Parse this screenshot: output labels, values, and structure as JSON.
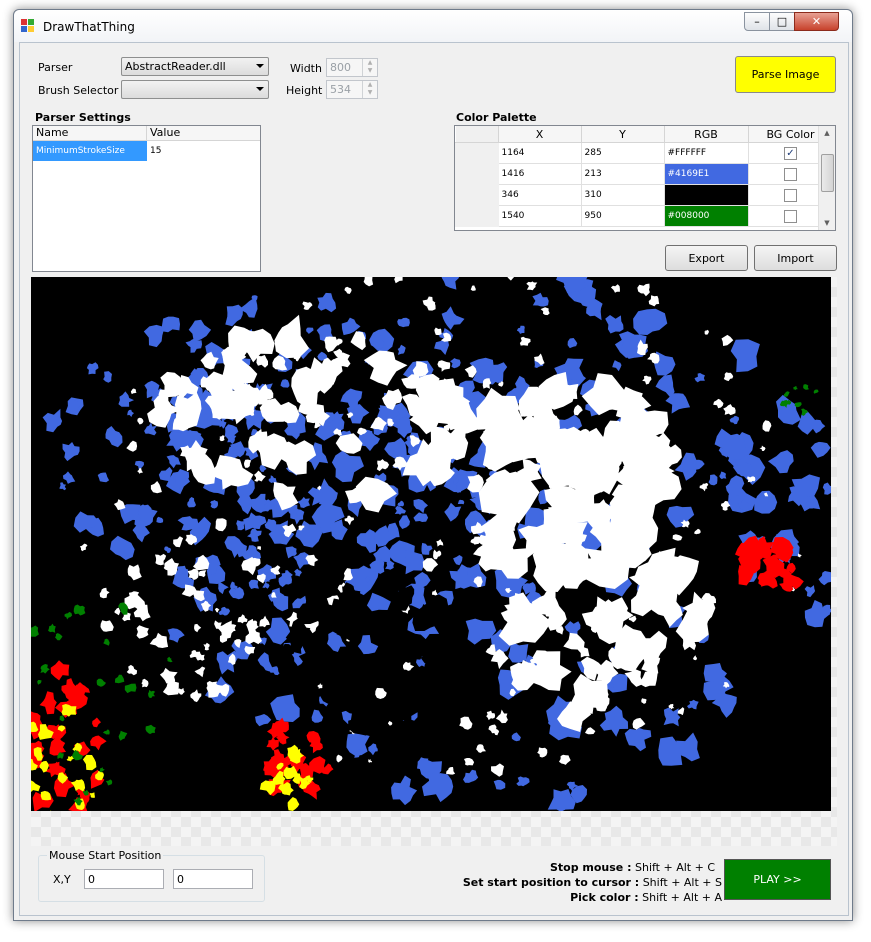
{
  "window": {
    "title": "DrawThatThing",
    "min_label": "–",
    "max_label": "□",
    "close_label": "✕"
  },
  "form": {
    "parser_label": "Parser",
    "parser_value": "AbstractReader.dll",
    "brush_label": "Brush Selector",
    "brush_value": "",
    "width_label": "Width",
    "width_value": "800",
    "height_label": "Height",
    "height_value": "534",
    "parse_button": "Parse Image"
  },
  "parser_settings": {
    "title": "Parser Settings",
    "columns": [
      "Name",
      "Value"
    ],
    "rows": [
      {
        "name": "MinimumStrokeSize",
        "value": "15"
      }
    ]
  },
  "color_palette": {
    "title": "Color Palette",
    "columns": [
      "X",
      "Y",
      "RGB",
      "BG Color"
    ],
    "rows": [
      {
        "x": "1164",
        "y": "285",
        "rgb": "#FFFFFF",
        "bg": true,
        "swatch": "#FFFFFF"
      },
      {
        "x": "1416",
        "y": "213",
        "rgb": "#4169E1",
        "bg": false,
        "swatch": "#4169E1"
      },
      {
        "x": "346",
        "y": "310",
        "rgb": "",
        "bg": false,
        "swatch": "#000000"
      },
      {
        "x": "1540",
        "y": "950",
        "rgb": "#008000",
        "bg": false,
        "swatch": "#008000"
      }
    ],
    "export_button": "Export",
    "import_button": "Import"
  },
  "image": {
    "palette": [
      "#000000",
      "#FFFFFF",
      "#4169E1",
      "#008000",
      "#FF0000",
      "#FFFF00"
    ]
  },
  "mouse_start": {
    "title": "Mouse Start Position",
    "xy_label": "X,Y",
    "x_value": "0",
    "y_value": "0"
  },
  "hotkeys": [
    {
      "action": "Stop mouse :",
      "keys": " Shift + Alt + C"
    },
    {
      "action": "Set start position to cursor :",
      "keys": " Shift + Alt + S"
    },
    {
      "action": "Pick color :",
      "keys": " Shift + Alt + A"
    }
  ],
  "play_button": "PLAY >>"
}
